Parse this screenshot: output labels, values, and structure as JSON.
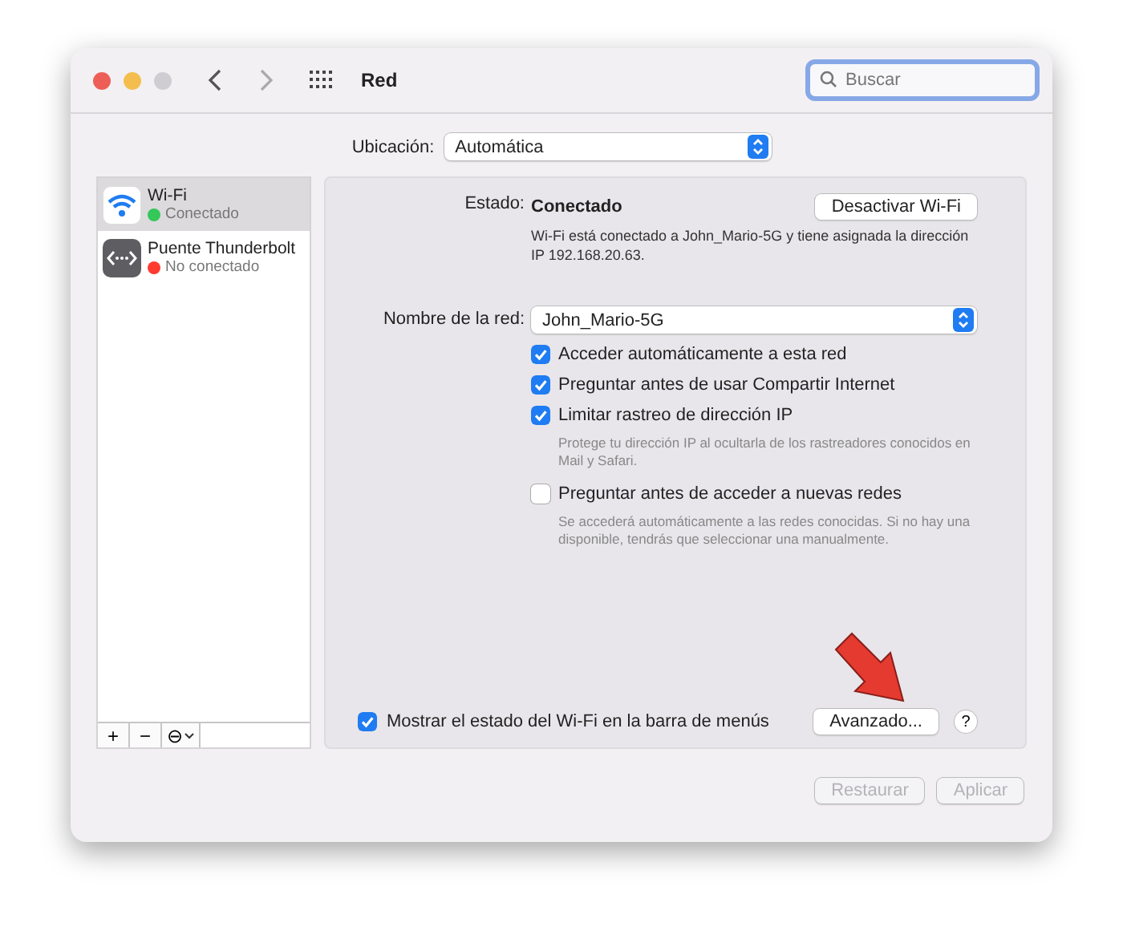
{
  "window": {
    "title": "Red"
  },
  "search": {
    "placeholder": "Buscar"
  },
  "location": {
    "label": "Ubicación:",
    "value": "Automática"
  },
  "services": [
    {
      "name": "Wi-Fi",
      "status": "Conectado",
      "color": "#34c759",
      "selected": true,
      "kind": "wifi"
    },
    {
      "name": "Puente Thunderbolt",
      "status": "No conectado",
      "color": "#ff3b30",
      "selected": false,
      "kind": "thunderbolt"
    }
  ],
  "sidebar_buttons": [
    "+",
    "−",
    "⊖"
  ],
  "status": {
    "label": "Estado:",
    "value": "Conectado",
    "description": "Wi-Fi está conectado a John_Mario-5G y tiene asignada la dirección IP 192.168.20.63.",
    "button": "Desactivar Wi-Fi"
  },
  "network": {
    "label": "Nombre de la red:",
    "value": "John_Mario-5G"
  },
  "options": [
    {
      "label": "Acceder automáticamente a esta red",
      "checked": true
    },
    {
      "label": "Preguntar antes de usar Compartir Internet",
      "checked": true
    },
    {
      "label": "Limitar rastreo de dirección IP",
      "checked": true,
      "note": "Protege tu dirección IP al ocultarla de los rastreadores conocidos en Mail y Safari."
    },
    {
      "label": "Preguntar antes de acceder a nuevas redes",
      "checked": false,
      "note": "Se accederá automáticamente a las redes conocidas. Si no hay una disponible, tendrás que seleccionar una manualmente."
    }
  ],
  "menu_bar_option": {
    "label": "Mostrar el estado del Wi-Fi en la barra de menús",
    "checked": true
  },
  "advanced_button": "Avanzado...",
  "help_button": "?",
  "footer_buttons": [
    {
      "label": "Restaurar",
      "disabled": true
    },
    {
      "label": "Aplicar",
      "disabled": true
    }
  ]
}
